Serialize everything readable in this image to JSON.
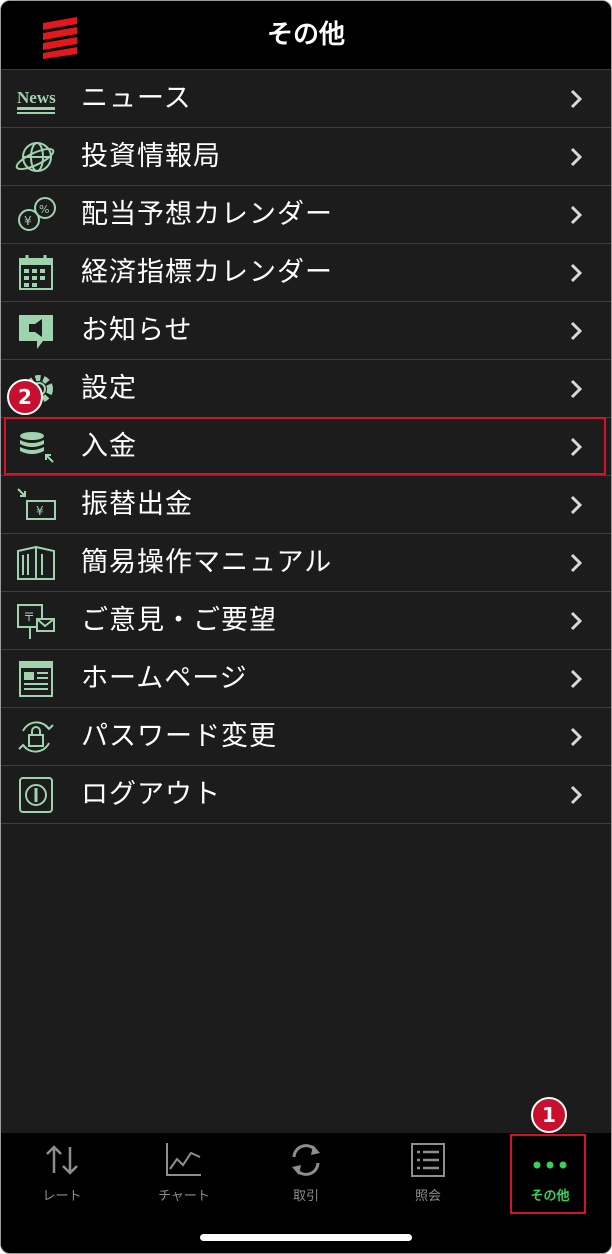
{
  "header": {
    "title": "その他"
  },
  "menu": [
    {
      "label": "ニュース",
      "icon": "news-icon"
    },
    {
      "label": "投資情報局",
      "icon": "globe-icon"
    },
    {
      "label": "配当予想カレンダー",
      "icon": "currency-coins-icon"
    },
    {
      "label": "経済指標カレンダー",
      "icon": "calendar-icon"
    },
    {
      "label": "お知らせ",
      "icon": "announcement-icon"
    },
    {
      "label": "設定",
      "icon": "gear-icon"
    },
    {
      "label": "入金",
      "icon": "deposit-coins-icon"
    },
    {
      "label": "振替出金",
      "icon": "transfer-withdraw-icon"
    },
    {
      "label": "簡易操作マニュアル",
      "icon": "manual-book-icon"
    },
    {
      "label": "ご意見・ご要望",
      "icon": "feedback-icon"
    },
    {
      "label": "ホームページ",
      "icon": "webpage-icon"
    },
    {
      "label": "パスワード変更",
      "icon": "password-lock-icon"
    },
    {
      "label": "ログアウト",
      "icon": "logout-icon"
    }
  ],
  "tabs": [
    {
      "label": "レート",
      "icon": "rate-arrows-icon"
    },
    {
      "label": "チャート",
      "icon": "chart-line-icon"
    },
    {
      "label": "取引",
      "icon": "trade-refresh-icon"
    },
    {
      "label": "照会",
      "icon": "inquiry-list-icon"
    },
    {
      "label": "その他",
      "icon": "more-dots-icon",
      "active": true
    }
  ],
  "annotations": {
    "badge_1": "1",
    "badge_2": "2"
  },
  "colors": {
    "accent_green": "#38d15a",
    "icon_green": "#9fd3ae",
    "highlight_red": "#d3132c",
    "logo_red": "#e0191e"
  }
}
